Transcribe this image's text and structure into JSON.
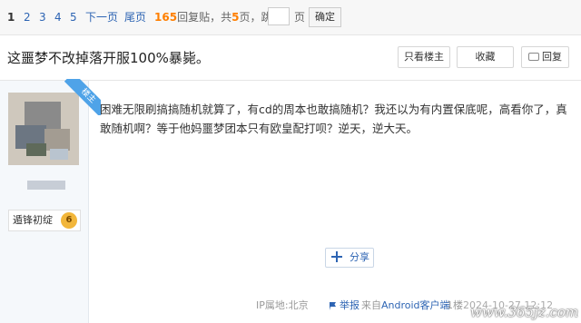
{
  "pager": {
    "current": "1",
    "pages": [
      "2",
      "3",
      "4",
      "5"
    ],
    "next": "下一页",
    "last": "尾页",
    "reply_count": "165",
    "reply_suffix": "回复贴，共",
    "total_pages": "5",
    "pages_suffix": "页，跳到",
    "jump_unit": "页",
    "confirm": "确定"
  },
  "thread": {
    "title": "这噩梦不改掉落开服100%暴毙。",
    "only_owner": "只看楼主",
    "favorite": "收藏",
    "reply": "回复"
  },
  "author": {
    "corner_tag": "楼主",
    "badge_label": "遁锋初绽",
    "level": "6"
  },
  "post": {
    "content": "困难无限刷搞搞随机就算了，有cd的周本也敢搞随机？我还以为有内置保底呢，高看你了，真敢随机啊？等于他妈噩梦团本只有欧皇配打呗？逆天，逆大天。",
    "share": "分享"
  },
  "meta": {
    "ip": "IP属地:北京",
    "report": "举报",
    "source_prefix": "来自",
    "source_link": "Android客户端",
    "floor": "1楼",
    "time": "2024-10-27 12:12"
  },
  "watermark": "www.365jz.com",
  "colors": {
    "link": "#2d64b3",
    "reply_count": "#ff7f00",
    "corner_tag": "#4fa3e8",
    "level_badge": "#f2b63a"
  },
  "icons": {
    "reply": "reply-icon",
    "share": "plus-icon",
    "report": "report-icon",
    "level": "level-badge-icon"
  }
}
